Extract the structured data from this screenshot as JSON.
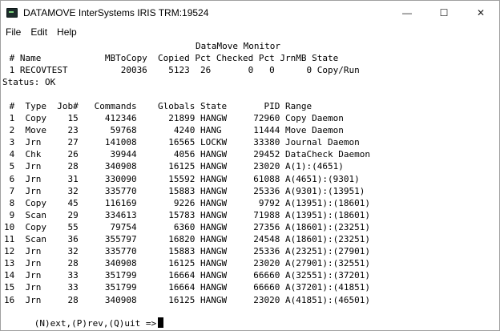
{
  "window": {
    "title": "DATAMOVE InterSystems IRIS TRM:19524",
    "minimize": "—",
    "maximize": "☐",
    "close": "✕"
  },
  "menu": [
    "File",
    "Edit",
    "Help"
  ],
  "terminal": {
    "header_title": "DataMove Monitor",
    "summary_header": " # Name            MBToCopy  Copied Pct Checked Pct JrnMB State",
    "summary_row": " 1 RECOVTEST          20036    5123  26       0   0      0 Copy/Run",
    "status": "Status: OK",
    "table_header": " #  Type  Job#   Commands    Globals State       PID Range",
    "rows": [
      " 1  Copy    15     412346      21899 HANGW     72960 Copy Daemon",
      " 2  Move    23      59768       4240 HANG      11444 Move Daemon",
      " 3  Jrn     27     141008      16565 LOCKW     33380 Journal Daemon",
      " 4  Chk     26      39944       4056 HANGW     29452 DataCheck Daemon",
      " 5  Jrn     28     340908      16125 HANGW     23020 A(1):(4651)",
      " 6  Jrn     31     330090      15592 HANGW     61088 A(4651):(9301)",
      " 7  Jrn     32     335770      15883 HANGW     25336 A(9301):(13951)",
      " 8  Copy    45     116169       9226 HANGW      9792 A(13951):(18601)",
      " 9  Scan    29     334613      15783 HANGW     71988 A(13951):(18601)",
      "10  Copy    55      79754       6360 HANGW     27356 A(18601):(23251)",
      "11  Scan    36     355797      16820 HANGW     24548 A(18601):(23251)",
      "12  Jrn     32     335770      15883 HANGW     25336 A(23251):(27901)",
      "13  Jrn     28     340908      16125 HANGW     23020 A(27901):(32551)",
      "14  Jrn     33     351799      16664 HANGW     66660 A(32551):(37201)",
      "15  Jrn     33     351799      16664 HANGW     66660 A(37201):(41851)",
      "16  Jrn     28     340908      16125 HANGW     23020 A(41851):(46501)"
    ],
    "prompt": "(N)ext,(P)rev,(Q)uit =>"
  }
}
